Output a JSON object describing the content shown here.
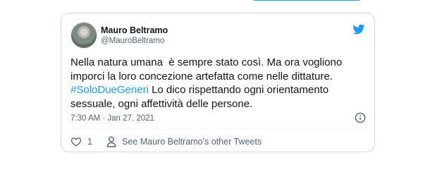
{
  "tweet": {
    "author_name": "Mauro Beltramo",
    "author_handle": "@MauroBeltramo",
    "text_part1": "Nella natura umana  è sempre stato così. Ma ora vogliono imporci la loro concezione artefatta come nelle dittature. ",
    "hashtag": "#SoloDueGeneri",
    "text_part2": " Lo dico rispettando ogni orientamento sessuale, ogni affettività delle persone.",
    "timestamp": "7:30 AM · Jan 27, 2021",
    "like_count": "1",
    "other_tweets_label": "See Mauro Beltramo's other Tweets"
  },
  "icons": {
    "platform": "twitter-bird-icon",
    "info": "info-icon",
    "like": "heart-icon",
    "profile": "person-icon"
  },
  "colors": {
    "accent": "#1d9bf0",
    "text": "#0f1419",
    "muted": "#536471",
    "border": "#cfd9de"
  }
}
